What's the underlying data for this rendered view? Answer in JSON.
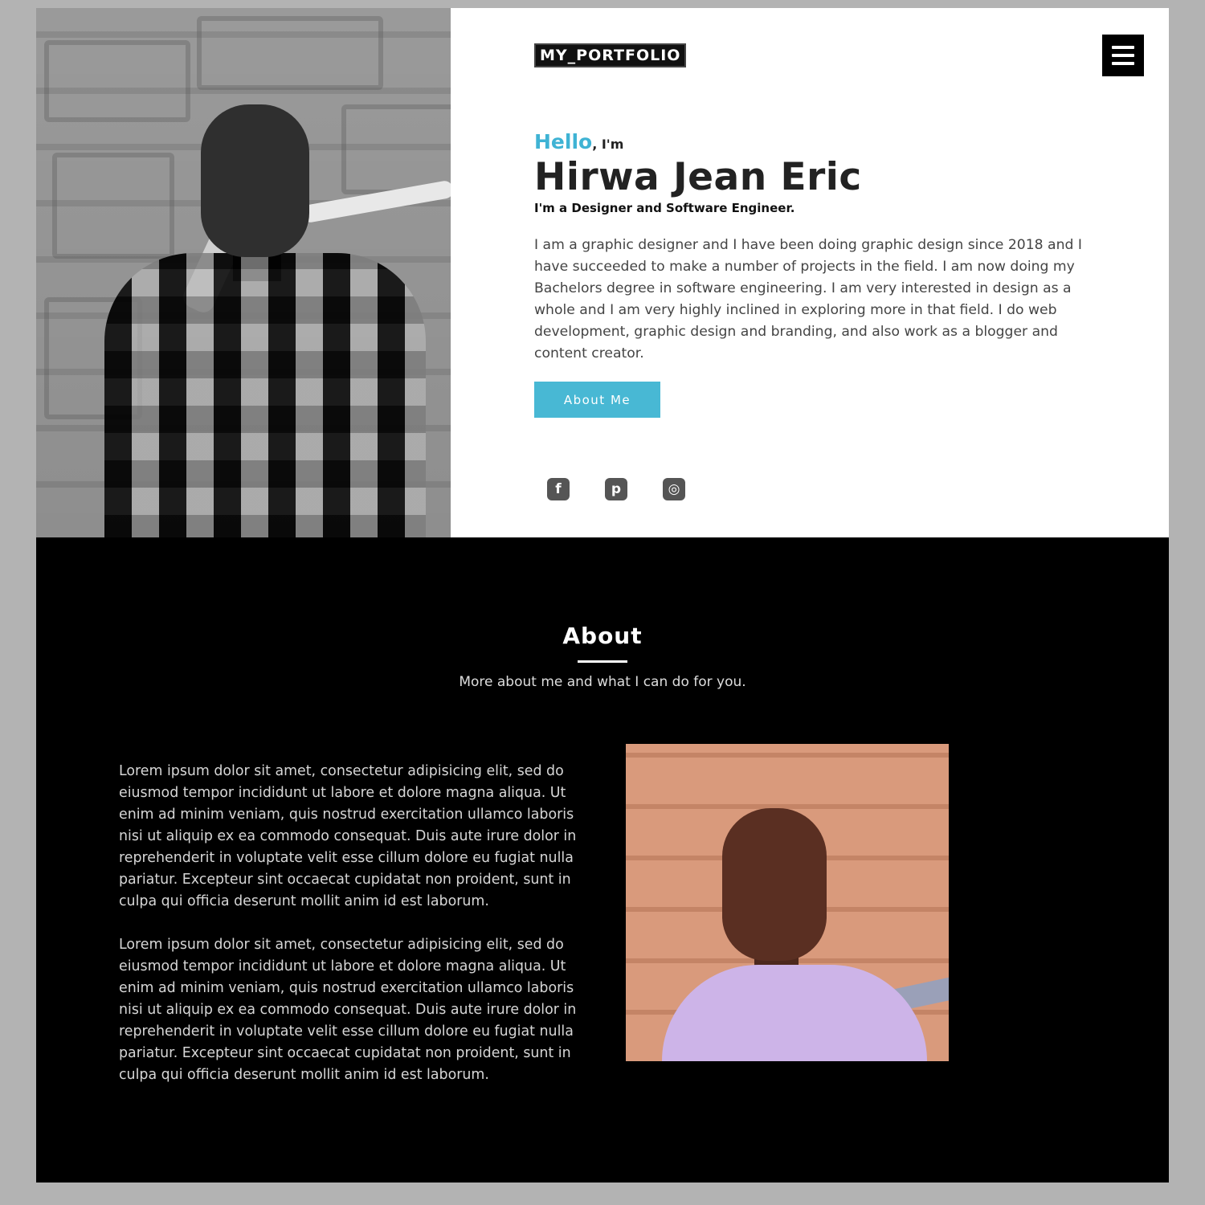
{
  "header": {
    "logo": "MY_PORTFOLIO",
    "menu_icon": "hamburger-menu-icon"
  },
  "hero": {
    "greeting": "Hello",
    "greeting_suffix": ", I'm",
    "name": "Hirwa Jean Eric",
    "tagline": "I'm a Designer and Software Engineer.",
    "bio": "I am a graphic designer and I have been doing graphic design since 2018 and I have succeeded to make a number of projects in the field. I am now doing my Bachelors degree in software engineering. I am very interested in design as a whole and I am very highly inclined in exploring more in that field. I do web development, graphic design and branding, and also work as a blogger and content creator.",
    "button_label": "About Me",
    "accent_color": "#48b8d4",
    "social": [
      {
        "icon": "facebook-icon",
        "glyph": "f"
      },
      {
        "icon": "pinterest-icon",
        "glyph": "p"
      },
      {
        "icon": "instagram-icon",
        "glyph": "◎"
      }
    ]
  },
  "about": {
    "title": "About",
    "subtitle": "More about me and what I can do for you.",
    "paragraphs": [
      "Lorem ipsum dolor sit amet, consectetur adipisicing elit, sed do eiusmod tempor incididunt ut labore et dolore magna aliqua. Ut enim ad minim veniam, quis nostrud exercitation ullamco laboris nisi ut aliquip ex ea commodo consequat. Duis aute irure dolor in reprehenderit in voluptate velit esse cillum dolore eu fugiat nulla pariatur. Excepteur sint occaecat cupidatat non proident, sunt in culpa qui officia deserunt mollit anim id est laborum.",
      "Lorem ipsum dolor sit amet, consectetur adipisicing elit, sed do eiusmod tempor incididunt ut labore et dolore magna aliqua. Ut enim ad minim veniam, quis nostrud exercitation ullamco laboris nisi ut aliquip ex ea commodo consequat. Duis aute irure dolor in reprehenderit in voluptate velit esse cillum dolore eu fugiat nulla pariatur. Excepteur sint occaecat cupidatat non proident, sunt in culpa qui officia deserunt mollit anim id est laborum."
    ]
  }
}
